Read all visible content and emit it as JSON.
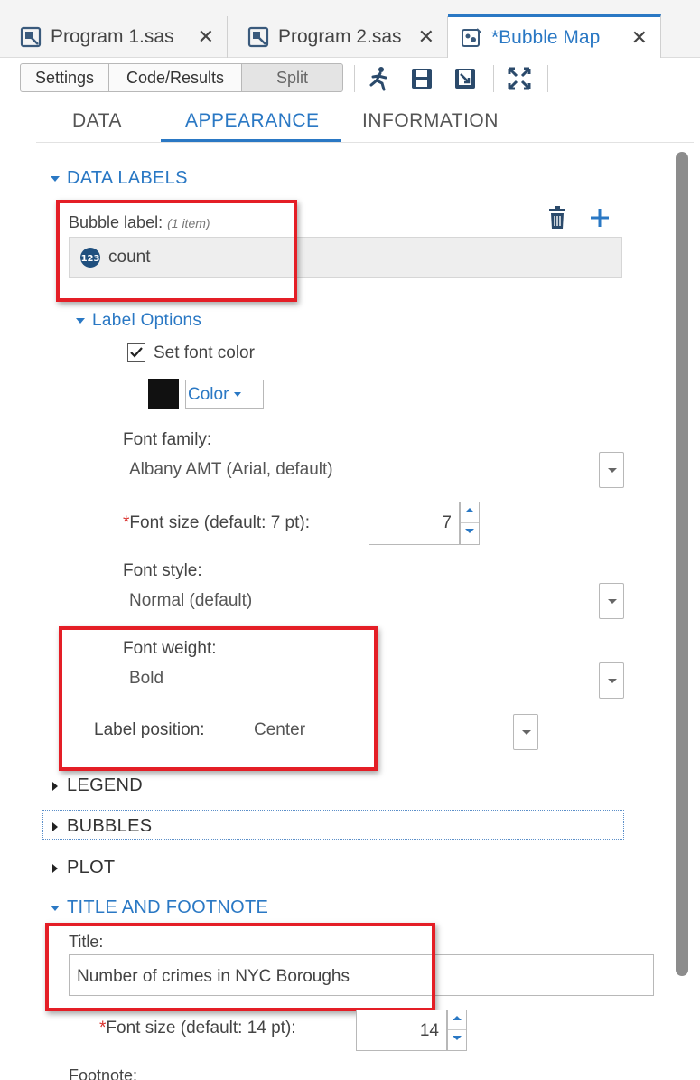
{
  "tabs": [
    {
      "label": "Program 1.sas",
      "icon": "program-icon"
    },
    {
      "label": "Program 2.sas",
      "icon": "program-icon"
    },
    {
      "label": "*Bubble Map",
      "icon": "bubble-map-icon"
    }
  ],
  "tab_close_glyph": "✕",
  "toolbar": {
    "settings_label": "Settings",
    "code_results_label": "Code/Results",
    "split_label": "Split",
    "icons": [
      "run-icon",
      "save-icon",
      "save-as-icon",
      "maximize-icon"
    ]
  },
  "section_tabs": [
    "DATA",
    "APPEARANCE",
    "INFORMATION"
  ],
  "data_labels": {
    "heading": "DATA LABELS",
    "bubble_label": "Bubble label:",
    "bubble_label_count": "(1 item)",
    "item": "count",
    "label_options_heading": "Label Options",
    "set_font_color_label": "Set font color",
    "set_font_color_checked": true,
    "color_swatch": "#111111",
    "color_button": "Color",
    "font_family_label": "Font family:",
    "font_family_value": "Albany AMT (Arial, default)",
    "font_size_label": "Font size (default: 7 pt):",
    "font_size_value": "7",
    "font_style_label": "Font style:",
    "font_style_value": "Normal (default)",
    "font_weight_label": "Font weight:",
    "font_weight_value": "Bold",
    "label_position_label": "Label position:",
    "label_position_value": "Center"
  },
  "collapsed_sections": [
    "LEGEND",
    "BUBBLES",
    "PLOT"
  ],
  "title_footnote": {
    "heading": "TITLE AND FOOTNOTE",
    "title_label": "Title:",
    "title_value": "Number of crimes in NYC Boroughs",
    "font_size_label": "Font size (default: 14 pt):",
    "font_size_value": "14",
    "footnote_label": "Footnote:"
  },
  "required_marker": "*",
  "colors": {
    "accent": "#2a78c4",
    "highlight_box": "#e41e26",
    "required": "#d9302c"
  }
}
